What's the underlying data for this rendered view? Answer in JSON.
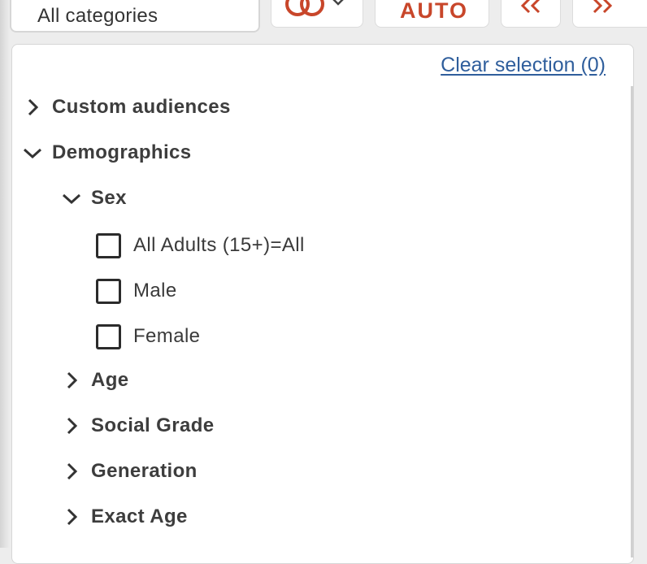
{
  "toolbar": {
    "category_select_value": "All categories",
    "auto_label": "AUTO",
    "accent_color": "#c8462a"
  },
  "panel": {
    "clear_selection": "Clear selection (0)"
  },
  "tree": {
    "custom_audiences": "Custom audiences",
    "demographics": "Demographics",
    "sex": "Sex",
    "sex_options": [
      "All Adults (15+)=All",
      "Male",
      "Female"
    ],
    "age": "Age",
    "social_grade": "Social Grade",
    "generation": "Generation",
    "exact_age": "Exact Age"
  },
  "icons": {
    "collapsed": "chevron-right-icon",
    "expanded": "chevron-down-icon",
    "rings": "linked-rings-icon",
    "prev": "double-chevron-left-icon",
    "next": "double-chevron-right-icon"
  }
}
